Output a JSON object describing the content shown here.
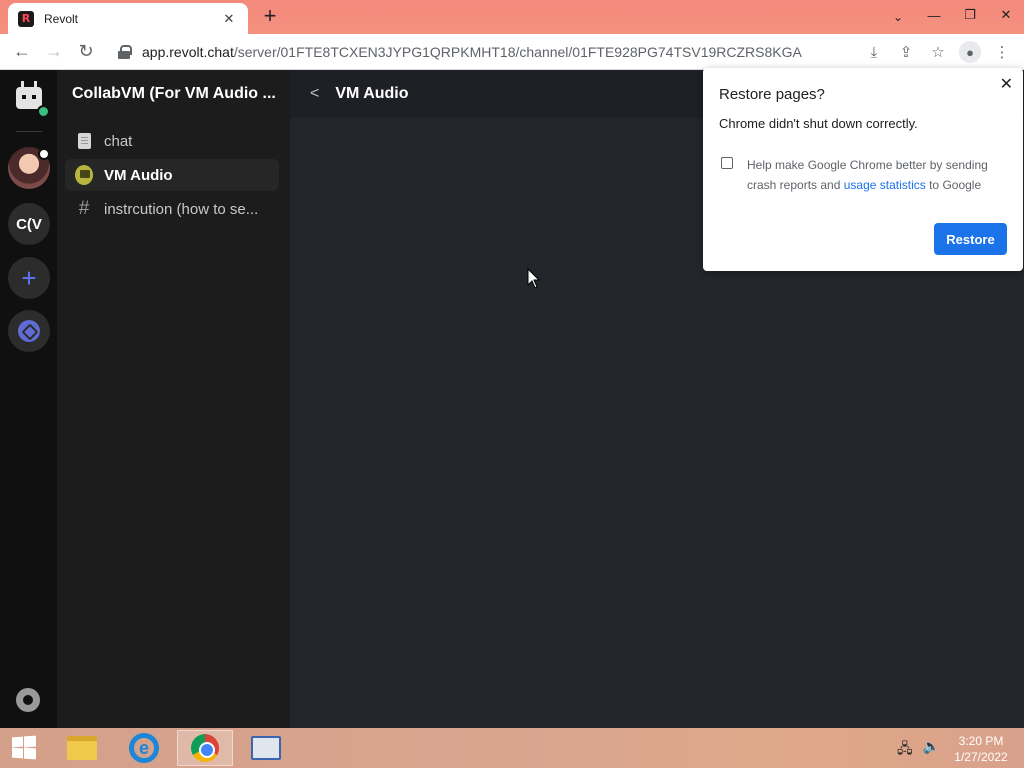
{
  "browser": {
    "tab_title": "Revolt",
    "tab_favicon_letter": "R",
    "url_host": "app.revolt.chat",
    "url_path": "/server/01FTE8TCXEN3JYPG1QRPKMHT18/channel/01FTE928PG74TSV19RCZRS8KGA"
  },
  "sidebar": {
    "server_initials": "C(V"
  },
  "channels": {
    "server_name": "CollabVM (For VM Audio ...",
    "items": [
      {
        "label": "chat",
        "icon": "text-channel-icon",
        "active": false
      },
      {
        "label": "VM Audio",
        "icon": "voice-channel-icon",
        "active": true
      },
      {
        "label": "instrcution (how to se...",
        "icon": "hash-icon",
        "active": false
      }
    ]
  },
  "main": {
    "channel_title": "VM Audio"
  },
  "restore_popup": {
    "title": "Restore pages?",
    "message": "Chrome didn't shut down correctly.",
    "option_prefix": "Help make Google Chrome better by sending crash reports and ",
    "option_link": "usage statistics",
    "option_suffix": " to Google",
    "button": "Restore",
    "checkbox_checked": false
  },
  "taskbar": {
    "time": "3:20 PM",
    "date": "1/27/2022"
  },
  "colors": {
    "accent_blue": "#1a73e8",
    "online_green": "#3abf7e",
    "revolt_red": "#ff4654"
  }
}
